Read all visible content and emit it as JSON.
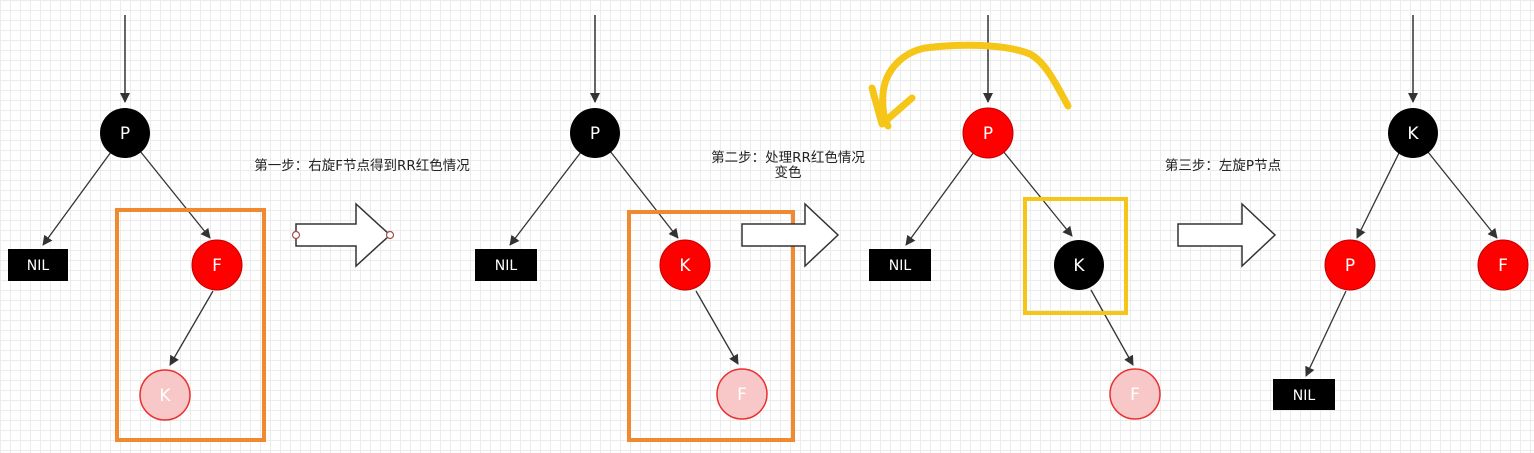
{
  "steps": [
    {
      "caption_lines": [
        "第一步：右旋F节点得到RR红色情况"
      ]
    },
    {
      "caption_lines": [
        "第二步：处理RR红色情况",
        "变色"
      ]
    },
    {
      "caption_lines": [
        "第三步：左旋P节点"
      ]
    }
  ],
  "trees": [
    {
      "nodes": [
        {
          "label": "P",
          "color": "black"
        },
        {
          "label": "NIL",
          "color": "nil"
        },
        {
          "label": "F",
          "color": "red"
        },
        {
          "label": "K",
          "color": "pink"
        }
      ]
    },
    {
      "nodes": [
        {
          "label": "P",
          "color": "black"
        },
        {
          "label": "NIL",
          "color": "nil"
        },
        {
          "label": "K",
          "color": "red"
        },
        {
          "label": "F",
          "color": "pink"
        }
      ]
    },
    {
      "nodes": [
        {
          "label": "P",
          "color": "red"
        },
        {
          "label": "NIL",
          "color": "nil"
        },
        {
          "label": "K",
          "color": "black"
        },
        {
          "label": "F",
          "color": "pink"
        }
      ]
    },
    {
      "nodes": [
        {
          "label": "K",
          "color": "black"
        },
        {
          "label": "P",
          "color": "red"
        },
        {
          "label": "F",
          "color": "red"
        },
        {
          "label": "NIL",
          "color": "nil"
        }
      ]
    }
  ],
  "colors": {
    "black_node": "#000000",
    "red_node": "#ff0000",
    "pink_node": "#f8c8c8",
    "pink_stroke": "#e83030",
    "highlight_orange": "#f08a30",
    "highlight_yellow": "#f5c518",
    "rotate_arrow": "#f5c518"
  }
}
